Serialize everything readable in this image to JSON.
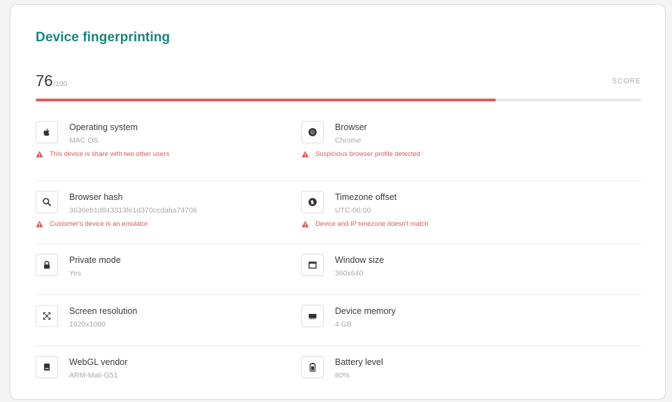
{
  "card": {
    "title": "Device fingerprinting",
    "score": {
      "value": "76",
      "max": "/100",
      "label": "SCORE",
      "fraction": 0.76
    }
  },
  "colors": {
    "title": "#16867a",
    "bar_fill": "#dd5d5d",
    "warning": "#d45a5a"
  },
  "items": [
    {
      "label": "Operating system",
      "value": "MAC OS",
      "icon": "apple-icon",
      "warning": "This device is share with two other users"
    },
    {
      "label": "Browser",
      "value": "Chrome",
      "icon": "chrome-icon",
      "warning": "Suspicious browser profile detected"
    },
    {
      "label": "Browser hash",
      "value": "3636eb1d843313fe1d370ccdaba74706",
      "icon": "search-icon",
      "warning": "Customer's device is an emulator"
    },
    {
      "label": "Timezone offset",
      "value": "UTC-06:00",
      "icon": "globe-icon",
      "warning": "Device and IP timezone doesn't match"
    },
    {
      "label": "Private mode",
      "value": "Yes",
      "icon": "lock-icon",
      "warning": ""
    },
    {
      "label": "Window size",
      "value": "360x640",
      "icon": "window-icon",
      "warning": ""
    },
    {
      "label": "Screen resolution",
      "value": "1920x1080",
      "icon": "resize-icon",
      "warning": ""
    },
    {
      "label": "Device memory",
      "value": "4 GB",
      "icon": "memory-icon",
      "warning": ""
    },
    {
      "label": "WebGL vendor",
      "value": "ARM-Mali-G51",
      "icon": "chip-icon",
      "warning": ""
    },
    {
      "label": "Battery level",
      "value": "80%",
      "icon": "battery-icon",
      "warning": ""
    }
  ]
}
